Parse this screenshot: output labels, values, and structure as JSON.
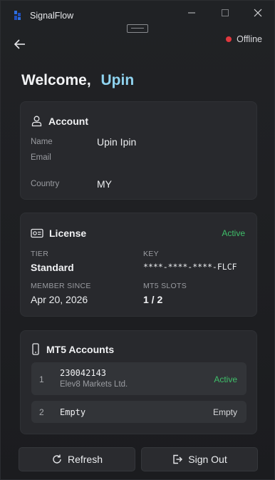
{
  "app": {
    "title": "SignalFlow"
  },
  "status": {
    "label": "Offline",
    "color": "#e0383e"
  },
  "welcome": {
    "greeting": "Welcome,",
    "name": "Upin"
  },
  "account": {
    "title": "Account",
    "name_label": "Name",
    "name_value": "Upin Ipin",
    "email_label": "Email",
    "email_value": "",
    "country_label": "Country",
    "country_value": "MY"
  },
  "license": {
    "title": "License",
    "status": "Active",
    "tier_label": "TIER",
    "tier_value": "Standard",
    "key_label": "KEY",
    "key_value": "****-****-****-FLCF",
    "member_since_label": "MEMBER SINCE",
    "member_since_value": "Apr 20, 2026",
    "slots_label": "MT5 SLOTS",
    "slots_value": "1 / 2"
  },
  "mt5": {
    "title": "MT5 Accounts",
    "accounts": [
      {
        "index": "1",
        "number": "230042143",
        "broker": "Elev8 Markets Ltd.",
        "status": "Active"
      },
      {
        "index": "2",
        "number": "Empty",
        "broker": "",
        "status": "Empty"
      }
    ]
  },
  "buttons": {
    "refresh": "Refresh",
    "sign_out": "Sign Out"
  },
  "colors": {
    "accent": "#8fd3ef",
    "active": "#3fbf6a",
    "offline": "#e0383e"
  }
}
